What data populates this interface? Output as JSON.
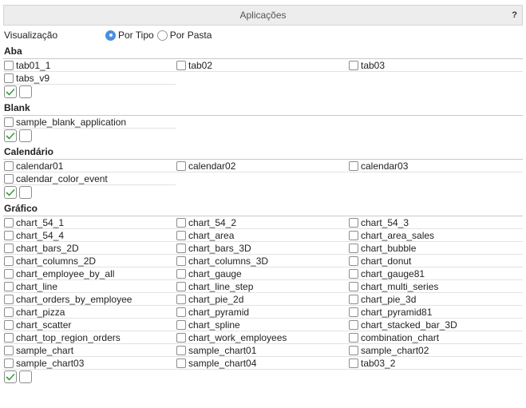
{
  "header": {
    "title": "Aplicações",
    "help": "?"
  },
  "view": {
    "label": "Visualização",
    "options": [
      {
        "label": "Por Tipo",
        "selected": true
      },
      {
        "label": "Por Pasta",
        "selected": false
      }
    ]
  },
  "sections": [
    {
      "title": "Aba",
      "items": [
        "tab01_1",
        "tab02",
        "tab03",
        "tabs_v9"
      ]
    },
    {
      "title": "Blank",
      "items": [
        "sample_blank_application"
      ]
    },
    {
      "title": "Calendário",
      "items": [
        "calendar01",
        "calendar02",
        "calendar03",
        "calendar_color_event"
      ]
    },
    {
      "title": "Gráfico",
      "items": [
        "chart_54_1",
        "chart_54_2",
        "chart_54_3",
        "chart_54_4",
        "chart_area",
        "chart_area_sales",
        "chart_bars_2D",
        "chart_bars_3D",
        "chart_bubble",
        "chart_columns_2D",
        "chart_columns_3D",
        "chart_donut",
        "chart_employee_by_all",
        "chart_gauge",
        "chart_gauge81",
        "chart_line",
        "chart_line_step",
        "chart_multi_series",
        "chart_orders_by_employee",
        "chart_pie_2d",
        "chart_pie_3d",
        "chart_pizza",
        "chart_pyramid",
        "chart_pyramid81",
        "chart_scatter",
        "chart_spline",
        "chart_stacked_bar_3D",
        "chart_top_region_orders",
        "chart_work_employees",
        "combination_chart",
        "sample_chart",
        "sample_chart01",
        "sample_chart02",
        "sample_chart03",
        "sample_chart04",
        "tab03_2"
      ]
    }
  ],
  "colors": {
    "accent": "#4a90e2",
    "check": "#3a9d3a"
  }
}
